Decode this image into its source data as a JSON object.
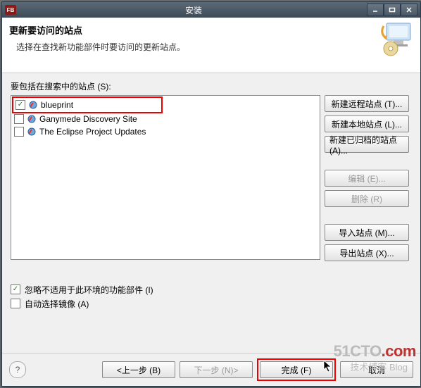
{
  "titlebar": {
    "app_badge": "FB",
    "title": "安装"
  },
  "banner": {
    "heading": "更新要访问的站点",
    "sub": "选择在查找新功能部件时要访问的更新站点。"
  },
  "list_label": "要包括在搜索中的站点 (S):",
  "sites": [
    {
      "name": "blueprint",
      "checked": true
    },
    {
      "name": "Ganymede Discovery Site",
      "checked": false
    },
    {
      "name": "The Eclipse Project Updates",
      "checked": false
    }
  ],
  "side": {
    "new_remote": "新建远程站点 (T)...",
    "new_local": "新建本地站点 (L)...",
    "new_archived": "新建已归档的站点 (A)...",
    "edit": "编辑 (E)...",
    "remove": "删除 (R)",
    "import": "导入站点 (M)...",
    "export": "导出站点 (X)..."
  },
  "opts": {
    "ignore_env": "忽略不适用于此环境的功能部件 (I)",
    "auto_mirror": "自动选择镜像 (A)"
  },
  "nav": {
    "back": "<上一步 (B)",
    "next": "下一步 (N)>",
    "finish": "完成 (F)",
    "cancel": "取消"
  },
  "watermark": {
    "line1_a": "51CTO",
    "line1_b": ".com",
    "line2": "技术博客 Blog"
  }
}
